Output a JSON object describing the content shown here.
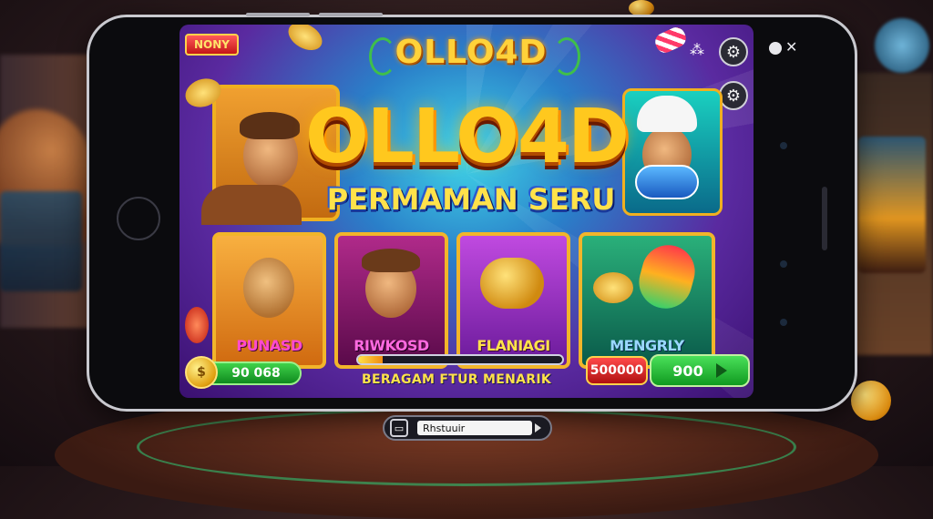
{
  "game": {
    "corner_tag": "NONY",
    "top_logo": "OLLO4D",
    "title": "OLLO4D",
    "subtitle": "PERMAMAN SERU"
  },
  "cards": [
    {
      "label": "PUNASD",
      "color": "#ff4ad0",
      "bg": "#f08a20"
    },
    {
      "label": "RIWKOSD",
      "color": "#ff4ad0",
      "bg": "#7a1a6a"
    },
    {
      "label": "FLANIAGI",
      "color": "#ffe24a",
      "bg": "#9a2ab0"
    },
    {
      "label": "MENGRLY",
      "color": "#7ad0ff",
      "bg": "#1a8a6a"
    }
  ],
  "bottom_bar": {
    "balance": "90 068",
    "progress": 0.12,
    "feature_text": "BERAGAM FTUR MENARIK",
    "bet": "500000",
    "spin_value": "900"
  },
  "footer_widget": {
    "field_text": "Rhstuuir"
  },
  "icons": [
    "settings-gear-icon",
    "settings-gear-icon",
    "pause-icon",
    "close-icon",
    "arrow-right-icon",
    "coin-icon",
    "screen-icon"
  ]
}
